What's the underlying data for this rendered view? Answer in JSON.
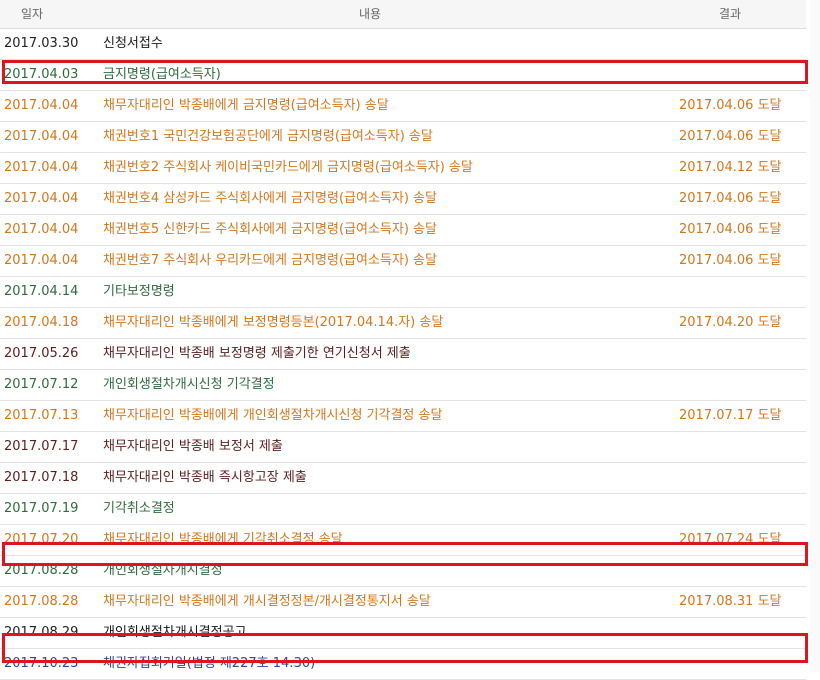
{
  "header": {
    "date": "일자",
    "content": "내용",
    "result": "결과"
  },
  "rows": [
    {
      "date": "2017.03.30",
      "content": "신청서접수",
      "result": ""
    },
    {
      "date": "2017.04.03",
      "content": "금지명령(급여소득자)",
      "result": ""
    },
    {
      "date": "2017.04.04",
      "content": "채무자대리인 박종배에게 금지명령(급여소득자) 송달",
      "result": "2017.04.06 도달"
    },
    {
      "date": "2017.04.04",
      "content": "채권번호1 국민건강보험공단에게 금지명령(급여소득자) 송달",
      "result": "2017.04.06 도달"
    },
    {
      "date": "2017.04.04",
      "content": "채권번호2 주식회사 케이비국민카드에게 금지명령(급여소득자) 송달",
      "result": "2017.04.12 도달"
    },
    {
      "date": "2017.04.04",
      "content": "채권번호4 삼성카드 주식회사에게 금지명령(급여소득자) 송달",
      "result": "2017.04.06 도달"
    },
    {
      "date": "2017.04.04",
      "content": "채권번호5 신한카드 주식회사에게 금지명령(급여소득자) 송달",
      "result": "2017.04.06 도달"
    },
    {
      "date": "2017.04.04",
      "content": "채권번호7 주식회사 우리카드에게 금지명령(급여소득자) 송달",
      "result": "2017.04.06 도달"
    },
    {
      "date": "2017.04.14",
      "content": "기타보정명령",
      "result": ""
    },
    {
      "date": "2017.04.18",
      "content": "채무자대리인 박종배에게 보정명령등본(2017.04.14.자) 송달",
      "result": "2017.04.20 도달"
    },
    {
      "date": "2017.05.26",
      "content": "채무자대리인 박종배 보정명령 제출기한 연기신청서 제출",
      "result": ""
    },
    {
      "date": "2017.07.12",
      "content": "개인회생절차개시신청 기각결정",
      "result": ""
    },
    {
      "date": "2017.07.13",
      "content": "채무자대리인 박종배에게 개인회생절차개시신청 기각결정 송달",
      "result": "2017.07.17 도달"
    },
    {
      "date": "2017.07.17",
      "content": "채무자대리인 박종배 보정서 제출",
      "result": ""
    },
    {
      "date": "2017.07.18",
      "content": "채무자대리인 박종배 즉시항고장 제출",
      "result": ""
    },
    {
      "date": "2017.07.19",
      "content": "기각취소결정",
      "result": ""
    },
    {
      "date": "2017.07.20",
      "content": "채무자대리인 박종배에게 기각취소결정 송달",
      "result": "2017.07.24 도달"
    },
    {
      "date": "2017.08.28",
      "content": "개인회생절차개시결정",
      "result": ""
    },
    {
      "date": "2017.08.28",
      "content": "채무자대리인 박종배에게 개시결정정본/개시결정통지서 송달",
      "result": "2017.08.31 도달"
    },
    {
      "date": "2017.08.29",
      "content": "개인회생절차개시결정공고",
      "result": ""
    },
    {
      "date": "2017.10.23",
      "content": "채권자집회기일(법정 제227호 14:30)",
      "result": ""
    }
  ],
  "colors": {
    "black": "#222222",
    "green": "#2f6b3c",
    "orange": "#d4771c",
    "maroon": "#5a1e1e",
    "blue": "#234a9c",
    "highlight": "#e0141e"
  }
}
